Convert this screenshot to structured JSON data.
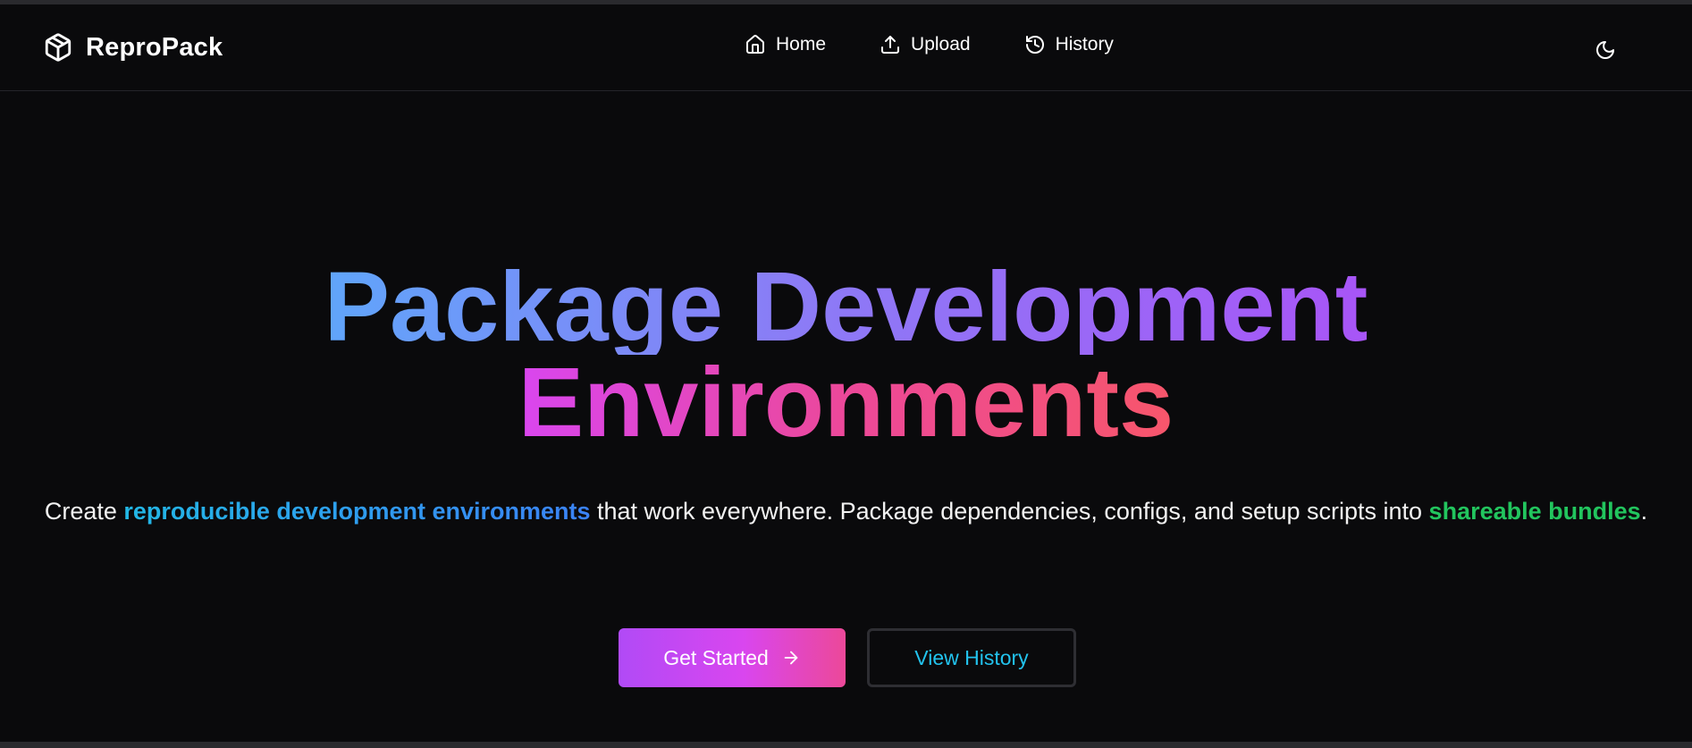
{
  "brand": {
    "name": "ReproPack",
    "icon": "package-icon"
  },
  "nav": {
    "items": [
      {
        "label": "Home",
        "icon": "home-icon"
      },
      {
        "label": "Upload",
        "icon": "upload-icon"
      },
      {
        "label": "History",
        "icon": "history-icon"
      }
    ],
    "theme_toggle_icon": "moon-icon"
  },
  "hero": {
    "headline_line1": "Package Development",
    "headline_line2": "Environments",
    "subtitle": {
      "part1": "Create ",
      "highlight1": "reproducible development environments",
      "part2": " that work everywhere. Package dependencies, configs, and setup scripts into ",
      "highlight2": "shareable bundles",
      "part3": "."
    }
  },
  "buttons": {
    "primary_label": "Get Started",
    "primary_icon": "arrow-right-icon",
    "secondary_label": "View History"
  },
  "colors": {
    "background": "#0a0a0c",
    "headline_gradient_1": [
      "#60a5fa",
      "#a855f7"
    ],
    "headline_gradient_2": [
      "#d946ef",
      "#f7566b"
    ],
    "highlight_blue": "#22b8e6",
    "highlight_green": "#22c55e",
    "primary_button_gradient": [
      "#b14af6",
      "#ec4899"
    ],
    "secondary_button_text": "#22c3ee"
  }
}
